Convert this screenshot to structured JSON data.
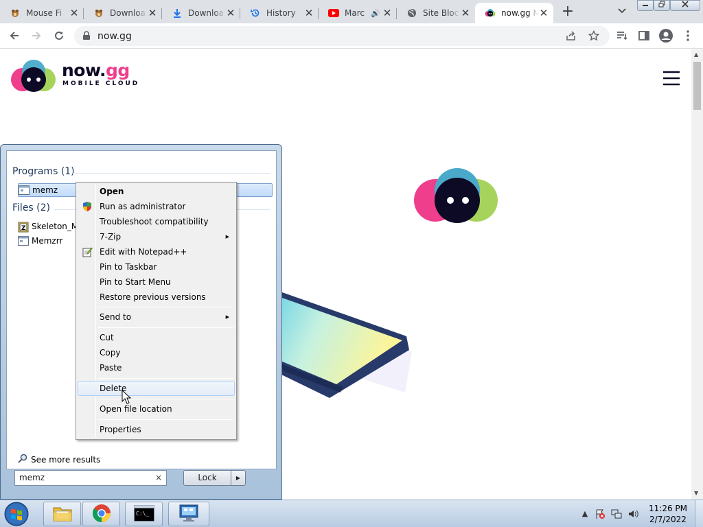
{
  "browser": {
    "tabs": [
      {
        "label": "Mouse Fi",
        "icon": "hedgehog-icon",
        "active": false
      },
      {
        "label": "Downloa",
        "icon": "hedgehog-icon",
        "active": false
      },
      {
        "label": "Downloa",
        "icon": "download-icon",
        "active": false
      },
      {
        "label": "History",
        "icon": "history-icon",
        "active": false
      },
      {
        "label": "Marc",
        "icon": "youtube-icon",
        "active": false,
        "audio": true
      },
      {
        "label": "Site Bloc",
        "icon": "globe-icon",
        "active": false
      },
      {
        "label": "now.gg M",
        "icon": "nowgg-icon",
        "active": true
      }
    ],
    "new_tab_label": "+",
    "close_glyph": "✕",
    "url": "now.gg"
  },
  "page": {
    "brand_name": "now.",
    "brand_suffix": "gg",
    "brand_tagline": "MOBILE CLOUD",
    "colors": {
      "pink": "#ee3e8c",
      "blue": "#4aa9c9",
      "green": "#a6d35b",
      "navy": "#0c0a24"
    }
  },
  "startmenu": {
    "programs_header": "Programs (1)",
    "files_header": "Files (2)",
    "programs": [
      {
        "label": "memz"
      }
    ],
    "files": [
      {
        "label": "Skeleton_M"
      },
      {
        "label": "Memzrr"
      }
    ],
    "see_more": "See more results",
    "search_value": "memz",
    "search_clear": "×",
    "lock_label": "Lock"
  },
  "context_menu": {
    "items": [
      {
        "label": "Open",
        "bold": true
      },
      {
        "label": "Run as administrator",
        "icon": "uac-shield-icon"
      },
      {
        "label": "Troubleshoot compatibility"
      },
      {
        "label": "7-Zip",
        "submenu": true
      },
      {
        "label": "Edit with Notepad++",
        "icon": "notepad-plus-plus-icon"
      },
      {
        "label": "Pin to Taskbar"
      },
      {
        "label": "Pin to Start Menu"
      },
      {
        "label": "Restore previous versions"
      },
      {
        "label": "Send to",
        "submenu": true
      },
      {
        "label": "Cut"
      },
      {
        "label": "Copy"
      },
      {
        "label": "Paste"
      },
      {
        "label": "Delete",
        "hover": true
      },
      {
        "label": "Open file location"
      },
      {
        "label": "Properties"
      }
    ]
  },
  "taskbar": {
    "apps": [
      "start-orb-icon",
      "explorer-icon",
      "chrome-icon",
      "cmd-icon",
      "control-panel-icon"
    ],
    "clock_time": "11:26 PM",
    "clock_date": "2/7/2022"
  }
}
